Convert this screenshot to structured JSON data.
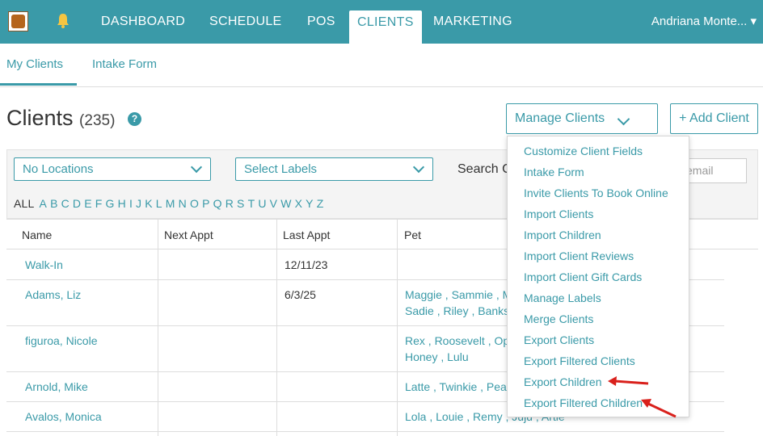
{
  "nav": {
    "items": [
      "DASHBOARD",
      "SCHEDULE",
      "POS",
      "CLIENTS",
      "MARKETING"
    ],
    "active": "CLIENTS",
    "user": "Andriana Monte... ▾"
  },
  "subnav": {
    "tabs": [
      "My Clients",
      "Intake Form"
    ],
    "active": "My Clients"
  },
  "header": {
    "title": "Clients",
    "count": "(235)",
    "help": "?"
  },
  "actions": {
    "manage": "Manage Clients",
    "add": "+ Add Client"
  },
  "filters": {
    "location": "No Locations",
    "labels": "Select Labels",
    "search_label": "Search C",
    "search_placeholder": "email"
  },
  "alphabet": [
    "ALL",
    "A",
    "B",
    "C",
    "D",
    "E",
    "F",
    "G",
    "H",
    "I",
    "J",
    "K",
    "L",
    "M",
    "N",
    "O",
    "P",
    "Q",
    "R",
    "S",
    "T",
    "U",
    "V",
    "W",
    "X",
    "Y",
    "Z"
  ],
  "table": {
    "columns": [
      "Name",
      "Next Appt",
      "Last Appt",
      "Pet"
    ],
    "rows": [
      {
        "name": "Walk-In",
        "next": "",
        "last": "12/11/23",
        "pets1": "",
        "pets2": ""
      },
      {
        "name": "Adams, Liz",
        "next": "",
        "last": "6/3/25",
        "pets1": "Maggie , Sammie , M",
        "pets2": "Sadie , Riley , Banks"
      },
      {
        "name": "figuroa, Nicole",
        "next": "",
        "last": "",
        "pets1": "Rex , Roosevelt , Op",
        "pets2": "Honey , Lulu"
      },
      {
        "name": "Arnold, Mike",
        "next": "",
        "last": "",
        "pets1": "Latte , Twinkie , Pea",
        "pets2": ""
      },
      {
        "name": "Avalos, Monica",
        "next": "",
        "last": "",
        "pets1": "Lola , Louie , Remy , Juju , Artie",
        "pets2": ""
      }
    ]
  },
  "menu": {
    "items": [
      "Customize Client Fields",
      "Intake Form",
      "Invite Clients To Book Online",
      "Import Clients",
      "Import Children",
      "Import Client Reviews",
      "Import Client Gift Cards",
      "Manage Labels",
      "Merge Clients",
      "Export Clients",
      "Export Filtered Clients",
      "Export Children",
      "Export Filtered Children"
    ]
  },
  "colors": {
    "accent": "#3a9aa8",
    "arrow": "#d9211c"
  }
}
